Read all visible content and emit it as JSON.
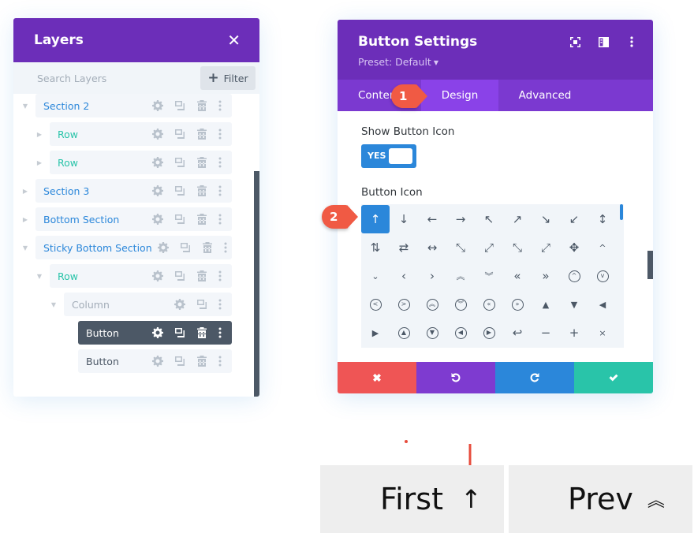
{
  "layers_panel": {
    "title": "Layers",
    "close_icon": "close-icon",
    "search_placeholder": "Search Layers",
    "filter_label": "Filter",
    "items": [
      {
        "label": "Section 2",
        "type": "section",
        "expanded": true,
        "active": false
      },
      {
        "label": "Row",
        "type": "row",
        "expanded": false,
        "active": false
      },
      {
        "label": "Row",
        "type": "row",
        "expanded": false,
        "active": false
      },
      {
        "label": "Section 3",
        "type": "section",
        "expanded": false,
        "active": false
      },
      {
        "label": "Bottom Section",
        "type": "section",
        "expanded": false,
        "active": false
      },
      {
        "label": "Sticky Bottom Section",
        "type": "section",
        "expanded": true,
        "active": false
      },
      {
        "label": "Row",
        "type": "row",
        "expanded": true,
        "active": false
      },
      {
        "label": "Column",
        "type": "column",
        "expanded": true,
        "active": false
      },
      {
        "label": "Button",
        "type": "module",
        "active": true
      },
      {
        "label": "Button",
        "type": "module",
        "active": false
      }
    ]
  },
  "settings_modal": {
    "title": "Button Settings",
    "preset": "Preset: Default",
    "header_icons": [
      "focus-icon",
      "sidebar-toggle-icon",
      "more-options-icon"
    ],
    "tabs": [
      {
        "label": "Content",
        "active": false
      },
      {
        "label": "Design",
        "active": true
      },
      {
        "label": "Advanced",
        "active": false
      }
    ],
    "show_button_icon": {
      "label": "Show Button Icon",
      "value": "YES"
    },
    "button_icon": {
      "label": "Button Icon",
      "selected_index": 0,
      "icons": [
        {
          "glyph": "↑",
          "name": "arrow-up-icon"
        },
        {
          "glyph": "↓",
          "name": "arrow-down-icon"
        },
        {
          "glyph": "←",
          "name": "arrow-left-icon"
        },
        {
          "glyph": "→",
          "name": "arrow-right-icon"
        },
        {
          "glyph": "↖",
          "name": "arrow-up-left-icon"
        },
        {
          "glyph": "↗",
          "name": "arrow-up-right-icon"
        },
        {
          "glyph": "↘",
          "name": "arrow-down-right-icon"
        },
        {
          "glyph": "↙",
          "name": "arrow-down-left-icon"
        },
        {
          "glyph": "↕",
          "name": "arrow-up-down-icon"
        },
        {
          "glyph": "⇅",
          "name": "arrows-vertical-icon"
        },
        {
          "glyph": "⇄",
          "name": "arrows-horizontal-icon"
        },
        {
          "glyph": "↔",
          "name": "arrow-left-right-icon"
        },
        {
          "glyph": "⤡",
          "name": "resize-diagonal-icon"
        },
        {
          "glyph": "⤢",
          "name": "expand-diagonal-icon"
        },
        {
          "glyph": "⤡",
          "name": "shrink-icon"
        },
        {
          "glyph": "⤢",
          "name": "expand-icon"
        },
        {
          "glyph": "✥",
          "name": "move-icon"
        },
        {
          "glyph": "^",
          "name": "chevron-up-icon",
          "small": true
        },
        {
          "glyph": "⌄",
          "name": "chevron-down-icon",
          "small": true
        },
        {
          "glyph": "‹",
          "name": "chevron-left-icon"
        },
        {
          "glyph": "›",
          "name": "chevron-right-icon"
        },
        {
          "glyph": "︽",
          "name": "double-chevron-up-icon",
          "small": true
        },
        {
          "glyph": "︾",
          "name": "double-chevron-down-icon",
          "small": true
        },
        {
          "glyph": "«",
          "name": "double-chevron-left-icon"
        },
        {
          "glyph": "»",
          "name": "double-chevron-right-icon"
        },
        {
          "glyph": "^",
          "name": "circle-chevron-up-icon",
          "circle": true
        },
        {
          "glyph": "v",
          "name": "circle-chevron-down-icon",
          "circle": true
        },
        {
          "glyph": "<",
          "name": "circle-chevron-left-icon",
          "circle": true
        },
        {
          "glyph": ">",
          "name": "circle-chevron-right-icon",
          "circle": true
        },
        {
          "glyph": "︽",
          "name": "circle-double-up-icon",
          "circle": true
        },
        {
          "glyph": "︾",
          "name": "circle-double-down-icon",
          "circle": true
        },
        {
          "glyph": "«",
          "name": "circle-double-left-icon",
          "circle": true
        },
        {
          "glyph": "»",
          "name": "circle-double-right-icon",
          "circle": true
        },
        {
          "glyph": "▲",
          "name": "triangle-up-icon",
          "small": true
        },
        {
          "glyph": "▼",
          "name": "triangle-down-icon",
          "small": true
        },
        {
          "glyph": "◀",
          "name": "triangle-left-icon",
          "small": true
        },
        {
          "glyph": "▶",
          "name": "triangle-right-icon",
          "small": true
        },
        {
          "glyph": "▲",
          "name": "circle-triangle-up-icon",
          "circle": true
        },
        {
          "glyph": "▼",
          "name": "circle-triangle-down-icon",
          "circle": true
        },
        {
          "glyph": "◀",
          "name": "circle-triangle-left-icon",
          "circle": true
        },
        {
          "glyph": "▶",
          "name": "circle-triangle-right-icon",
          "circle": true
        },
        {
          "glyph": "↩",
          "name": "return-icon"
        },
        {
          "glyph": "−",
          "name": "minus-icon"
        },
        {
          "glyph": "+",
          "name": "plus-icon"
        },
        {
          "glyph": "×",
          "name": "close-x-icon",
          "small": true
        }
      ]
    },
    "footer_buttons": [
      {
        "name": "cancel",
        "icon": "close-icon",
        "color": "#ef5555"
      },
      {
        "name": "undo",
        "icon": "undo-icon",
        "color": "#7e3bd0"
      },
      {
        "name": "redo",
        "icon": "redo-icon",
        "color": "#2b87da"
      },
      {
        "name": "save",
        "icon": "check-icon",
        "color": "#29c4a9"
      }
    ]
  },
  "annotations": {
    "step_1": "1",
    "step_2": "2"
  },
  "preview_buttons": [
    {
      "label": "First",
      "icon": "↑",
      "icon_name": "arrow-up-icon"
    },
    {
      "label": "Prev",
      "icon": "︽",
      "icon_name": "double-chevron-up-icon"
    }
  ],
  "colors": {
    "header_purple": "#6c2eb9",
    "tab_purple": "#7b39d0",
    "active_tab": "#8a42e8",
    "accent_blue": "#2b87da",
    "section_blue": "#2b87da",
    "row_green": "#29c4a9",
    "badge_red": "#f05a44"
  }
}
